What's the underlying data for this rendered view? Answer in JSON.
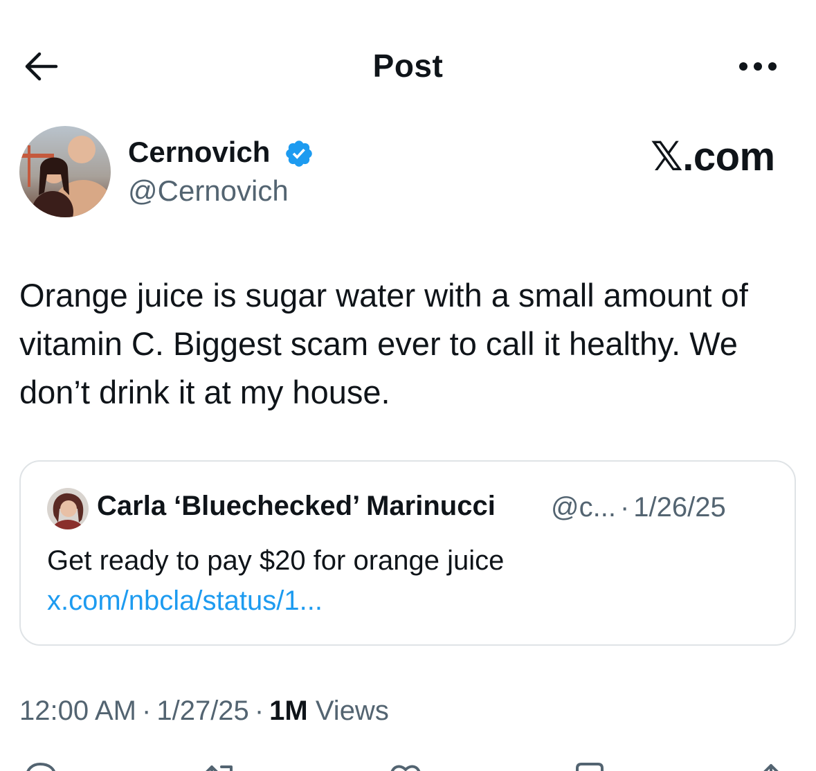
{
  "header": {
    "title": "Post",
    "back_icon": "arrow-left-icon",
    "more_icon": "more-horizontal-icon"
  },
  "author": {
    "name": "Cernovich",
    "handle": "@Cernovich",
    "verified": true,
    "verified_color": "#1d9bf0"
  },
  "watermark": "𝕏.com",
  "tweet": {
    "text": "Orange juice is sugar water with a small amount of vitamin C. Biggest scam ever to call it healthy. We don’t drink it at my house."
  },
  "quote": {
    "name": "Carla ‘Bluechecked’ Marinucci",
    "handle": "@c...",
    "separator": "·",
    "date": "1/26/25",
    "text": "Get ready to pay $20 for orange juice",
    "link": "x.com/nbcla/status/1..."
  },
  "meta": {
    "time": "12:00 AM",
    "separator": "·",
    "date": "1/27/25",
    "views_count": "1M",
    "views_label": "Views"
  },
  "actions": [
    "reply-icon",
    "repost-icon",
    "like-icon",
    "bookmark-icon",
    "share-icon"
  ],
  "colors": {
    "text": "#0f1419",
    "secondary": "#536471",
    "link": "#1d9bf0",
    "border": "#dfe3e6"
  }
}
